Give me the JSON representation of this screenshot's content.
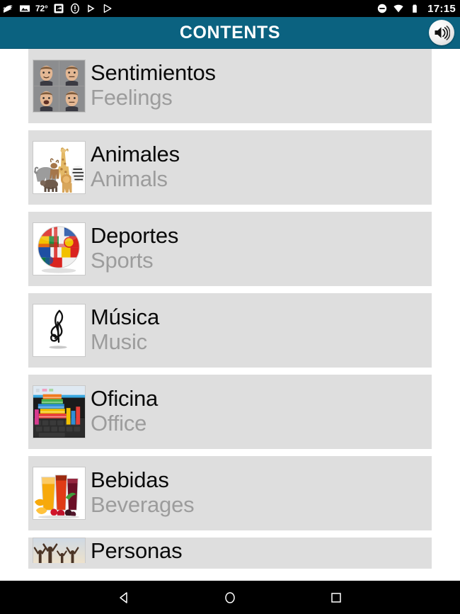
{
  "status_bar": {
    "left_icons": [
      {
        "name": "weather-wind-icon",
        "label": "weather"
      },
      {
        "name": "photo-icon",
        "label": "photos"
      },
      {
        "name": "temperature-text",
        "label": "72°"
      },
      {
        "name": "screenshot-icon",
        "label": "screenshot"
      },
      {
        "name": "warning-icon",
        "label": "alert"
      },
      {
        "name": "play-store-icon",
        "label": "play store"
      },
      {
        "name": "play-icon",
        "label": "play"
      }
    ],
    "temperature": "72°",
    "right_icons": [
      {
        "name": "do-not-disturb-icon",
        "label": "do not disturb"
      },
      {
        "name": "wifi-icon",
        "label": "wifi"
      },
      {
        "name": "battery-icon",
        "label": "battery"
      }
    ],
    "clock": "17:15"
  },
  "header": {
    "title": "CONTENTS",
    "speaker_button_name": "speaker-icon",
    "background_color": "#0b6280",
    "title_color": "#ffffff"
  },
  "list": {
    "items": [
      {
        "primary": "Sentimientos",
        "secondary": "Feelings",
        "thumb_name": "thumbnail-feelings",
        "thumb_kind": "faces"
      },
      {
        "primary": "Animales",
        "secondary": "Animals",
        "thumb_name": "thumbnail-animals",
        "thumb_kind": "animals"
      },
      {
        "primary": "Deportes",
        "secondary": "Sports",
        "thumb_name": "thumbnail-sports",
        "thumb_kind": "flagball"
      },
      {
        "primary": "Música",
        "secondary": "Music",
        "thumb_name": "thumbnail-music",
        "thumb_kind": "clef"
      },
      {
        "primary": "Oficina",
        "secondary": "Office",
        "thumb_name": "thumbnail-office",
        "thumb_kind": "office"
      },
      {
        "primary": "Bebidas",
        "secondary": "Beverages",
        "thumb_name": "thumbnail-beverages",
        "thumb_kind": "drinks"
      },
      {
        "primary": "Personas",
        "secondary": "",
        "thumb_name": "thumbnail-people",
        "thumb_kind": "people"
      }
    ],
    "card_color": "#dedede",
    "primary_text_color": "#0a0a0a",
    "secondary_text_color": "#9c9c9c"
  },
  "nav_bar": {
    "back_label": "Back",
    "home_label": "Home",
    "recents_label": "Recent apps"
  }
}
